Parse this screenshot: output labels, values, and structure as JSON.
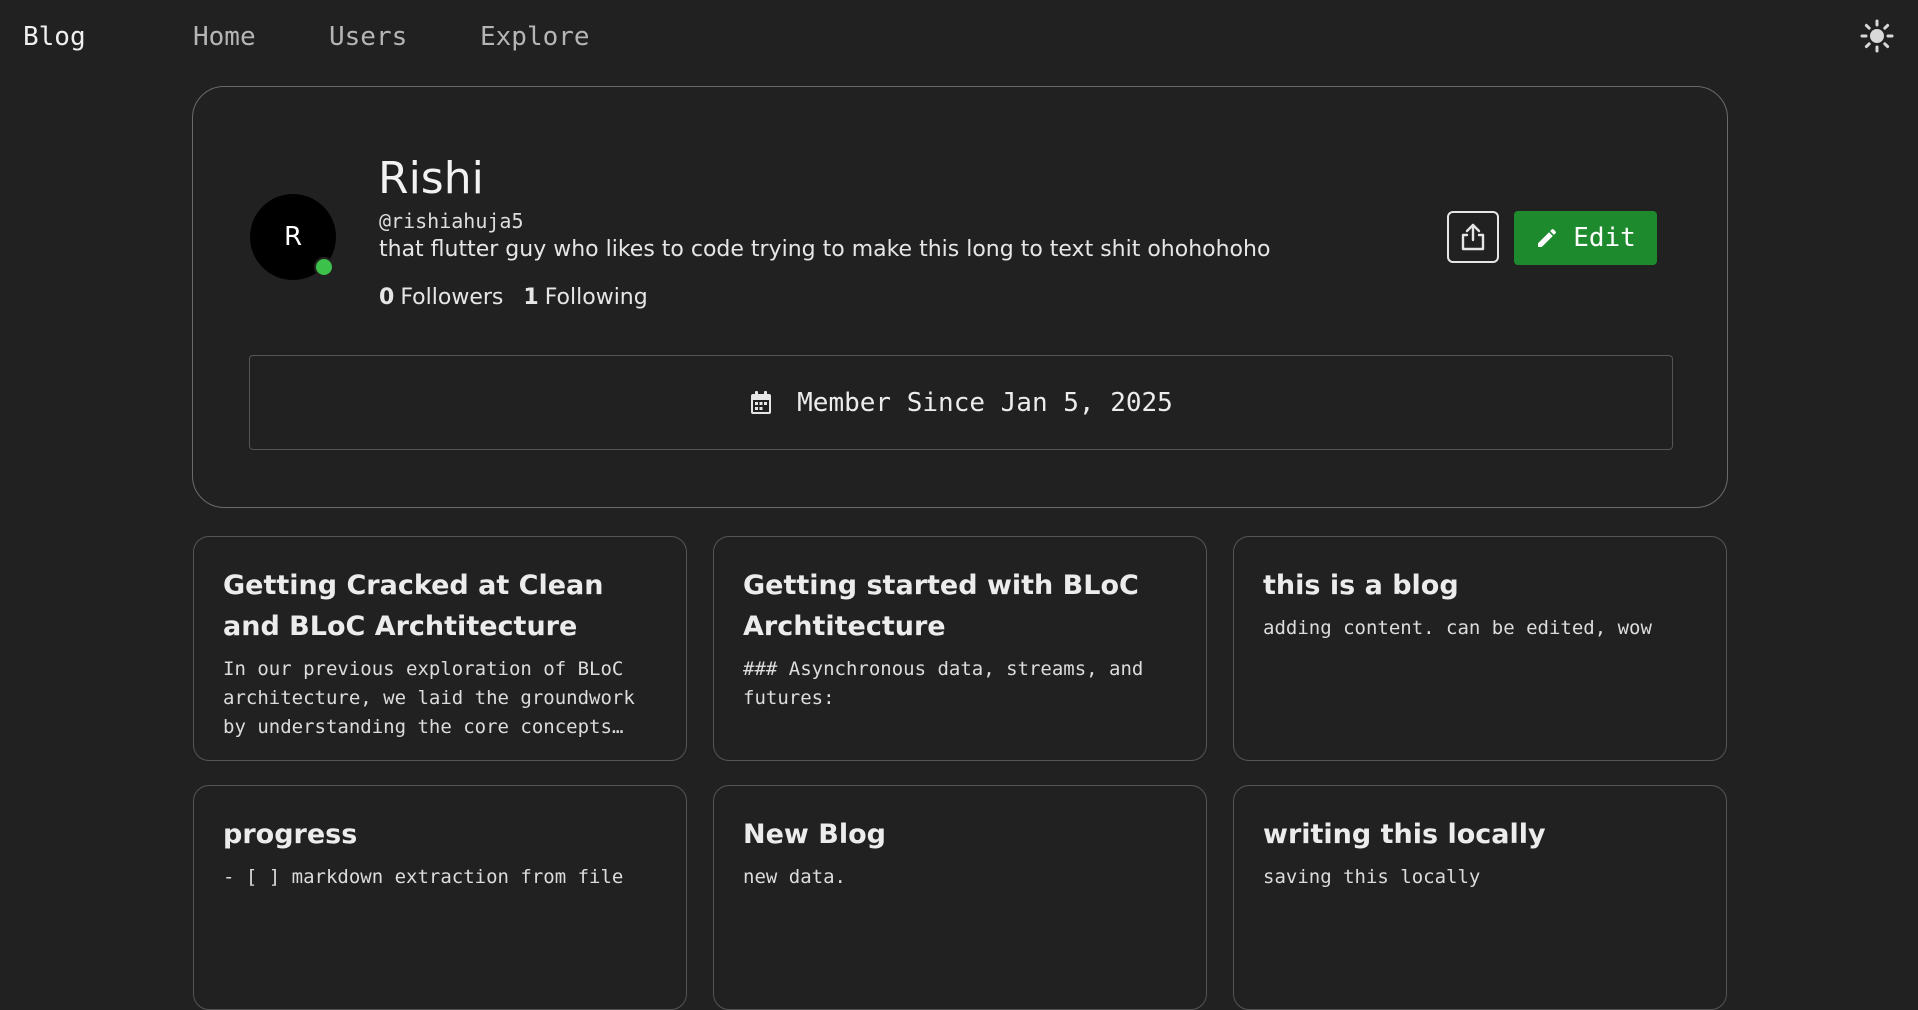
{
  "navbar": {
    "brand": "Blog",
    "links": [
      "Home",
      "Users",
      "Explore"
    ],
    "theme_icon": "sun-icon"
  },
  "profile": {
    "avatar_initial": "R",
    "online": true,
    "name": "Rishi",
    "handle": "@rishiahuja5",
    "bio": "that flutter guy who likes to code trying to make this long to text shit ohohohoho",
    "followers_count": "0",
    "followers_label": "Followers",
    "following_count": "1",
    "following_label": "Following",
    "share_icon": "share-icon",
    "edit_label": "Edit",
    "member_since": "Member Since Jan 5, 2025",
    "calendar_icon": "calendar-icon"
  },
  "posts": [
    {
      "title": "Getting Cracked at Clean and BLoC Archtitecture",
      "excerpt": "In our previous exploration of BLoC architecture, we laid the groundwork by understanding the core concepts and patterns"
    },
    {
      "title": "Getting started with BLoC Archtitecture",
      "excerpt": "### Asynchronous data, streams, and futures:"
    },
    {
      "title": "this is a blog",
      "excerpt": "adding content. can be edited, wow"
    },
    {
      "title": "progress",
      "excerpt": "- [ ] markdown extraction from file"
    },
    {
      "title": "New Blog",
      "excerpt": "new data."
    },
    {
      "title": "writing this locally",
      "excerpt": "saving this locally"
    }
  ],
  "colors": {
    "background": "#212121",
    "accent_green": "#1e8a2e",
    "online_dot": "#3cc14a",
    "border": "#555555"
  }
}
